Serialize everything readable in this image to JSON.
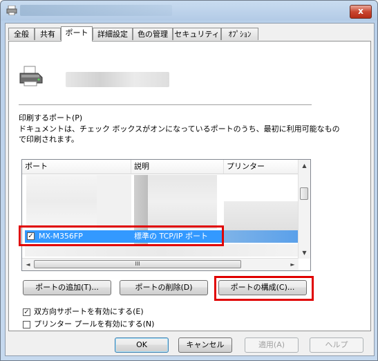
{
  "tabs": [
    "全般",
    "共有",
    "ポート",
    "詳細設定",
    "色の管理",
    "セキュリティ",
    "ｵﾌﾟｼｮﾝ"
  ],
  "active_tab": "ポート",
  "titlebar": {
    "close_label": "x"
  },
  "ports_section": {
    "label": "印刷するポート(P)",
    "description_line1": "ドキュメントは、チェック ボックスがオンになっているポートのうち、最初に利用可能なもの",
    "description_line2": "で印刷されます。"
  },
  "port_list": {
    "columns": [
      "ポート",
      "説明",
      "プリンター"
    ],
    "selected_row": {
      "port": "MX-M356FP",
      "description": "標準の TCP/IP ポート",
      "checked": true
    }
  },
  "scrollbar": {
    "up": "▲",
    "down": "▼",
    "left": "◄",
    "right": "►",
    "grip": "III"
  },
  "buttons": {
    "add_port": "ポートの追加(T)...",
    "delete_port": "ポートの削除(D)",
    "configure_port": "ポートの構成(C)..."
  },
  "options": {
    "bidirectional": {
      "label": "双方向サポートを有効にする(E)",
      "checked": true
    },
    "pooling": {
      "label": "プリンター プールを有効にする(N)",
      "checked": false
    }
  },
  "footer": {
    "ok": "OK",
    "cancel": "キャンセル",
    "apply": "適用(A)",
    "help": "ヘルプ"
  },
  "colors": {
    "selection": "#3399ff",
    "highlight_box": "#e00000"
  }
}
